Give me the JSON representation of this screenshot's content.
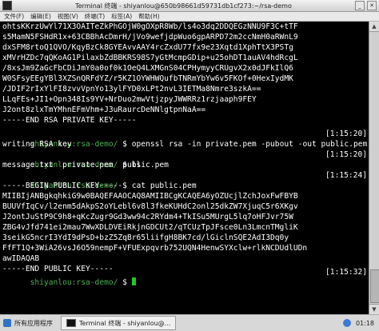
{
  "window": {
    "title": "Terminal 终端 - shiyanlou@650b98661d59731db1cf273:~/rsa-demo",
    "close_glyph": "✕",
    "minimize_glyph": "_"
  },
  "menu": [
    "文件(F)",
    "编辑(E)",
    "视图(V)",
    "终端(T)",
    "标签(A)",
    "帮助(H)"
  ],
  "terminal": {
    "lines": [
      "ohtsKKrzUwYl71X3OAITeZkPhGOjW0gOXpR8Wb/ls4o3dq2DDQEGzNNU9F3C+tTF",
      "s5MamN5FSHdR1x+63CBBhAcDmrH/jVo9wefjdpWuo6gpARPD72m2ccNmH0aRWnL9",
      "dxSFM8rtoQ1QVO/KqyBzCk8GYEAvvAAY4rcZxdU77fx9e23Xqtd1XphTtX3PSTg",
      "xMVrHZDc7qQKoAG1PilaxbZdBBKRS98S7yGtMcmpGDip+u25ohDT1auAV4hdRcgL",
      "/8xsJm9ZaGcFbCDiJmY0a0of0k1OeQ4LXMGnS04CPHymyyCRUgvX2x0dJFkIlQ6",
      "W0SFsyEEgYBl3XZSnQRFdYZ/r5KZ1OYWHWQufbTNRmYbYw6v5FKOf+0HexIydMK",
      "/JDIF2rIxYlFI8zvvVpnYo13ylFYD0xLPt2nvL3IETMa8Nmre3szkA==",
      "LLqFEs+JI1+Opn348Is9YV+NrDuo2mwVtjzpyJWWRRz1rzjaaph9FEY",
      "J2ont8zlxTmYMhnEFmVhm+J3uRaurcDeNNlgtpnNaA==",
      "-----END RSA PRIVATE KEY-----",
      "",
      "writing RSA key",
      "",
      "message.txt  private.pem  public.pem",
      "",
      "-----BEGIN PUBLIC KEY-----",
      "MIIBIjANBgkqhkiG9w0BAQEFAAOCAQ8AMIIBCgKCAQEA6yOZUcjlZchJoxFwFBYB",
      "BUUVfIqCv/l2enm5dAkpS2oYLebl6v8l3fkeKUHdC2onl25dkZW7XjuqC5r6XKgv",
      "J2ontJuStP9C9h8+qKcZugr9Gd3ww94c2RYdm4+TkISu5MUrgL5lq7oHFJvr75W",
      "ZBG4vJfd741ei2mau7WwXDLDVEiRkjnGDCUt2/qTCUzTpJFsce0Ln3LmcnTMgliK",
      "3seikG5ncrI3YdI9dPsD+bzZ5ZqBr65liifgH8BK7cd/lGiclnSQE2AdI3Dq0y",
      "FfFT1Q+3WiA26vsJ6O59nempF+VFUExpqvrb752UQN4HenwSYXclw+rlkNCDUdlUDn",
      "awIDAQAB",
      "-----END PUBLIC KEY-----"
    ],
    "prompts": [
      {
        "user": "shiyanlou",
        "sep": ":",
        "path": "rsa-demo/",
        "sym": " $ ",
        "cmd": "openssl rsa -in private.pem -pubout -out public.pem",
        "ts": "[1:15:20]"
      },
      {
        "user": "shiyanlou",
        "sep": ":",
        "path": "rsa-demo/",
        "sym": " $ ",
        "cmd": "ls",
        "ts": "[1:15:20]"
      },
      {
        "user": "shiyanlou",
        "sep": ":",
        "path": "rsa-demo/",
        "sym": " $ ",
        "cmd": "cat public.pem",
        "ts": "[1:15:24]"
      },
      {
        "user": "shiyanlou",
        "sep": ":",
        "path": "rsa-demo/",
        "sym": " $ ",
        "cmd": "",
        "ts": "[1:15:32]"
      }
    ]
  },
  "taskbar": {
    "start_label": "所有应用程序",
    "task_label": "Terminal 终端 - shiyanlou@...",
    "clock": "01:18"
  }
}
